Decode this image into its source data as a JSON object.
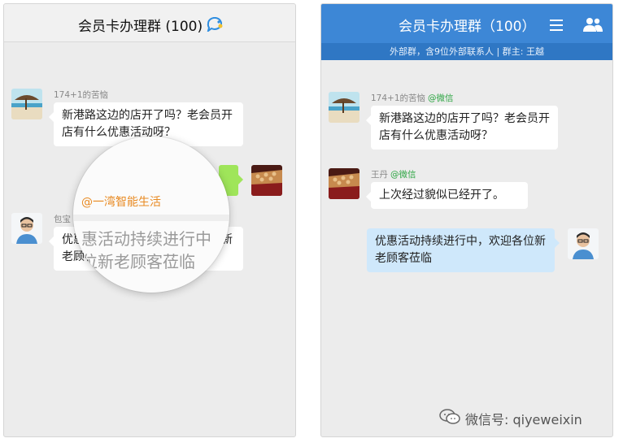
{
  "left": {
    "title": "会员卡办理群 (100)",
    "messages": [
      {
        "sender": "174+1的苦恼",
        "text": "新港路这边的店开了吗？老会员开店有什么优惠活动呀？"
      },
      {
        "sender": "包宝",
        "text": "优惠活动持续进行中，欢迎各位新老顾客莅临"
      }
    ],
    "magnifier": {
      "mention": "@一湾智能生活",
      "line1": "惠活动持续进行中",
      "line2": "位新老顾客莅临"
    }
  },
  "right": {
    "title": "会员卡办理群（100）",
    "subtitle": "外部群，含9位外部联系人 | 群主: 王越",
    "messages": [
      {
        "sender": "174+1的苦恼",
        "tag": "@微信",
        "text": "新港路这边的店开了吗？老会员开店有什么优惠活动呀？"
      },
      {
        "sender": "王丹",
        "tag": "@微信",
        "text": "上次经过貌似已经开了。"
      },
      {
        "sender": "",
        "tag": "",
        "text": "优惠活动持续进行中，欢迎各位新老顾客莅临"
      }
    ]
  },
  "watermark": "微信号: qiyeweixin",
  "colors": {
    "header_blue": "#3d87d6",
    "own_bubble": "#cfe8fb",
    "mention_orange": "#e88a22",
    "tag_green": "#2ca542"
  }
}
